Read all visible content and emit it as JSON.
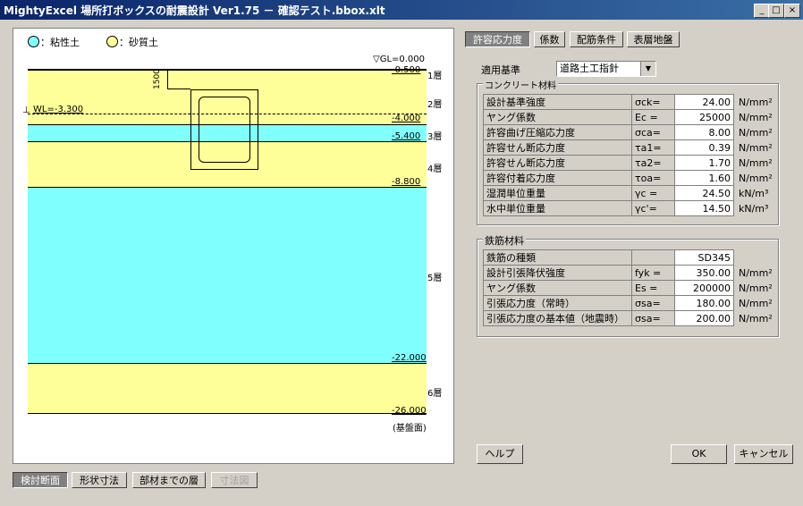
{
  "window": {
    "title": "MightyExcel 場所打ボックスの耐震設計 Ver1.75 － 確認テスト.bbox.xlt",
    "minimize": "_",
    "maximize": "□",
    "close": "×"
  },
  "legend": {
    "clay_label": "：粘性土",
    "sand_label": "：砂質土",
    "clay_color": "#80ffff",
    "sand_color": "#ffff99"
  },
  "drawing": {
    "gl_label": "▽GL=0.000",
    "wl_label": "WL=-3.300",
    "cover_dim": "1500",
    "depths": [
      "-0.500",
      "-4.000",
      "-5.400",
      "-8.800",
      "-22.000",
      "-26.000"
    ],
    "layers": [
      "1層",
      "2層",
      "3層",
      "4層",
      "5層",
      "6層"
    ],
    "base_label": "(基盤面)"
  },
  "bottom_tabs": [
    "検討断面",
    "形状寸法",
    "部材までの層",
    "寸法図"
  ],
  "top_tabs": [
    "許容応力度",
    "係数",
    "配筋条件",
    "表層地盤"
  ],
  "standard": {
    "label": "適用基準",
    "value": "道路土工指針"
  },
  "concrete": {
    "title": "コンクリート材料",
    "rows": [
      {
        "name": "設計基準強度",
        "sym": "σck=",
        "value": "24.00",
        "unit": "N/mm²"
      },
      {
        "name": "ヤング係数",
        "sym": "Ec =",
        "value": "25000",
        "unit": "N/mm²"
      },
      {
        "name": "許容曲げ圧縮応力度",
        "sym": "σca=",
        "value": "8.00",
        "unit": "N/mm²"
      },
      {
        "name": "許容せん断応力度",
        "sym": "τa1=",
        "value": "0.39",
        "unit": "N/mm²"
      },
      {
        "name": "許容せん断応力度",
        "sym": "τa2=",
        "value": "1.70",
        "unit": "N/mm²"
      },
      {
        "name": "許容付着応力度",
        "sym": "τoa=",
        "value": "1.60",
        "unit": "N/mm²"
      },
      {
        "name": "湿潤単位重量",
        "sym": "γc =",
        "value": "24.50",
        "unit": "kN/m³"
      },
      {
        "name": "水中単位重量",
        "sym": "γc'=",
        "value": "14.50",
        "unit": "kN/m³"
      }
    ]
  },
  "rebar": {
    "title": "鉄筋材料",
    "rows": [
      {
        "name": "鉄筋の種類",
        "sym": "",
        "value": "SD345",
        "unit": ""
      },
      {
        "name": "設計引張降伏強度",
        "sym": "fyk =",
        "value": "350.00",
        "unit": "N/mm²"
      },
      {
        "name": "ヤング係数",
        "sym": "Es =",
        "value": "200000",
        "unit": "N/mm²"
      },
      {
        "name": "引張応力度（常時）",
        "sym": "σsa=",
        "value": "180.00",
        "unit": "N/mm²"
      },
      {
        "name": "引張応力度の基本値（地震時）",
        "sym": "σsa=",
        "value": "200.00",
        "unit": "N/mm²"
      }
    ]
  },
  "buttons": {
    "help": "ヘルプ",
    "ok": "OK",
    "cancel": "キャンセル"
  }
}
